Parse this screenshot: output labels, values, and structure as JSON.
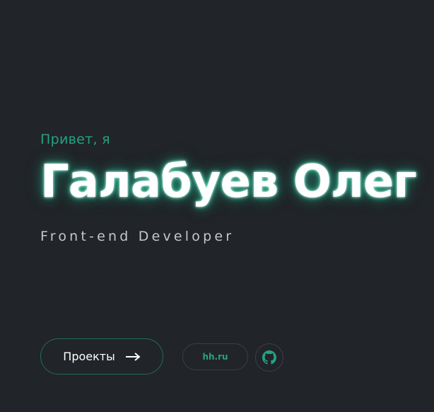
{
  "hero": {
    "greeting": "Привет, я",
    "name": "Галабуев Олег",
    "role": "Front-end Developer"
  },
  "actions": {
    "projects_label": "Проекты",
    "projects_icon": "arrow-right-icon",
    "hh_label": "hh.ru",
    "github_icon": "github-icon"
  },
  "colors": {
    "background": "#212428",
    "accent": "#22a481",
    "text": "#ffffff",
    "muted_text": "#c4c7cc",
    "border": "#3b4047"
  }
}
